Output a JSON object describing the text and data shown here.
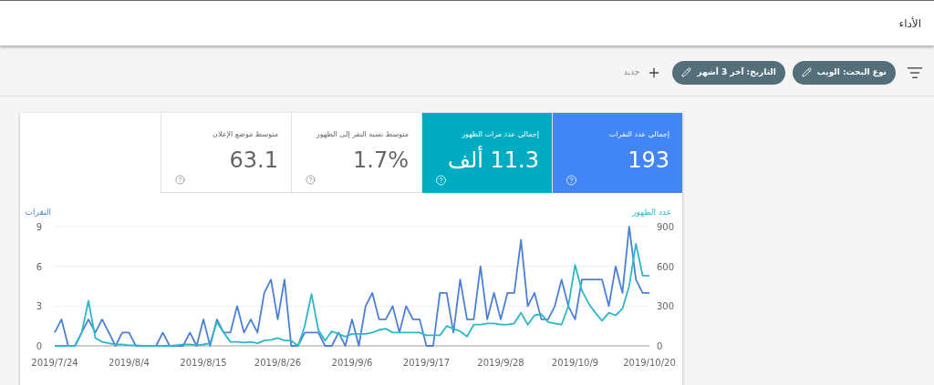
{
  "header": {
    "title": "الأداء"
  },
  "toolbar": {
    "chips": [
      {
        "label": "نوع البحث: الويب"
      },
      {
        "label": "التاريخ: آخر 3 أشهر"
      }
    ],
    "new_label": "جديد"
  },
  "metrics": [
    {
      "label": "إجمالي عدد النقرات",
      "value": "193",
      "selected": true,
      "color": "#4285f4"
    },
    {
      "label": "إجمالي عدد مرات الظهور",
      "value": "11.3 ألف",
      "selected": true,
      "color": "#00acc1"
    },
    {
      "label": "متوسط نسبة النقر إلى الظهور",
      "value": "1.7%",
      "selected": false
    },
    {
      "label": "متوسط موضع الإعلان",
      "value": "63.1",
      "selected": false
    }
  ],
  "chart": {
    "chart_data": {
      "type": "line",
      "yticks": [
        0,
        3,
        6,
        9
      ],
      "ylim": [
        0,
        9
      ],
      "y2ticks": [
        0,
        300,
        600,
        900
      ],
      "y2lim": [
        0,
        900
      ],
      "categories": [
        "2019/7/24",
        null,
        null,
        null,
        null,
        null,
        null,
        null,
        null,
        null,
        null,
        "2019/8/4",
        null,
        null,
        null,
        null,
        null,
        null,
        null,
        null,
        null,
        null,
        "2019/8/15",
        null,
        null,
        null,
        null,
        null,
        null,
        null,
        null,
        null,
        null,
        "2019/8/26",
        null,
        null,
        null,
        null,
        null,
        null,
        null,
        null,
        null,
        null,
        "2019/9/6",
        null,
        null,
        null,
        null,
        null,
        null,
        null,
        null,
        null,
        null,
        "2019/9/17",
        null,
        null,
        null,
        null,
        null,
        null,
        null,
        null,
        null,
        null,
        "2019/9/28",
        null,
        null,
        null,
        null,
        null,
        null,
        null,
        null,
        null,
        null,
        "2019/10/9",
        null,
        null,
        null,
        null,
        null,
        null,
        null,
        null,
        null,
        null,
        "2019/10/20"
      ],
      "series": [
        {
          "name": "النقرات",
          "color": "#4a80d8",
          "values": [
            1,
            2,
            0,
            0,
            1,
            2,
            1,
            2,
            1,
            0,
            1,
            1,
            0,
            0,
            0,
            0,
            1,
            0,
            0,
            0,
            1,
            0,
            2,
            0,
            2,
            1,
            1,
            3,
            1,
            2,
            1,
            4,
            5,
            2,
            5,
            0,
            0,
            1,
            1,
            1,
            0,
            0,
            1,
            0,
            2,
            0,
            3,
            4,
            2,
            2,
            3,
            1,
            3,
            2,
            2,
            0,
            0,
            4,
            4,
            1,
            5,
            2,
            2,
            6,
            2,
            4,
            2,
            4,
            4,
            8,
            3,
            4,
            2,
            2,
            3,
            5,
            3,
            2,
            5,
            5,
            5,
            5,
            3,
            6,
            4,
            9,
            5,
            4,
            4
          ]
        },
        {
          "name": "عدد الظهور",
          "color": "#2bb8c8",
          "axis": "y2",
          "values": [
            0,
            0,
            0,
            0,
            100,
            340,
            60,
            30,
            20,
            10,
            10,
            5,
            5,
            0,
            0,
            0,
            0,
            0,
            5,
            10,
            10,
            5,
            10,
            20,
            180,
            100,
            30,
            30,
            25,
            30,
            20,
            40,
            45,
            60,
            40,
            40,
            0,
            150,
            390,
            120,
            40,
            110,
            90,
            70,
            90,
            90,
            90,
            100,
            120,
            130,
            100,
            100,
            100,
            100,
            100,
            80,
            80,
            80,
            150,
            130,
            110,
            70,
            160,
            160,
            170,
            170,
            160,
            160,
            170,
            250,
            160,
            230,
            240,
            180,
            170,
            160,
            300,
            610,
            420,
            320,
            250,
            190,
            250,
            230,
            280,
            450,
            770,
            530,
            530
          ]
        }
      ]
    }
  }
}
